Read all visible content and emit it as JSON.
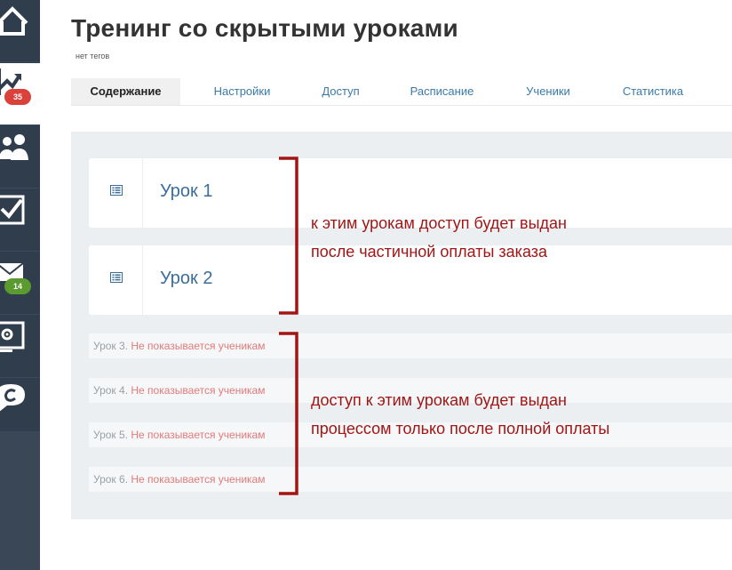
{
  "sidebar": {
    "items": [
      {
        "icon": "home-icon",
        "badge": ""
      },
      {
        "icon": "chart-line-icon",
        "badge": "35",
        "badge_color": "#d9413a"
      },
      {
        "icon": "users-icon",
        "badge": ""
      },
      {
        "icon": "checkbox-icon",
        "badge": ""
      },
      {
        "icon": "mail-icon",
        "badge": "14",
        "badge_color": "#5a9a2f"
      },
      {
        "icon": "settings-screen-icon",
        "badge": ""
      },
      {
        "icon": "chat-icon",
        "badge": ""
      }
    ]
  },
  "header": {
    "title": "Тренинг со скрытыми уроками",
    "tags": "нет тегов"
  },
  "tabs": [
    {
      "label": "Содержание",
      "active": true
    },
    {
      "label": "Настройки",
      "active": false
    },
    {
      "label": "Доступ",
      "active": false
    },
    {
      "label": "Расписание",
      "active": false
    },
    {
      "label": "Ученики",
      "active": false
    },
    {
      "label": "Статистика",
      "active": false
    }
  ],
  "lessons": [
    {
      "title": "Урок 1",
      "icon": "lesson-list-icon"
    },
    {
      "title": "Урок 2",
      "icon": "lesson-list-icon"
    }
  ],
  "hidden_lessons": [
    {
      "label": "Урок 3.",
      "note": "Не показывается ученикам"
    },
    {
      "label": "Урок 4.",
      "note": "Не показывается ученикам"
    },
    {
      "label": "Урок 5.",
      "note": "Не показывается ученикам"
    },
    {
      "label": "Урок 6.",
      "note": "Не показывается ученикам"
    }
  ],
  "annotations": {
    "partial": [
      "к этим урокам доступ будет выдан",
      "после частичной оплаты заказа"
    ],
    "full": [
      "доступ к этим урокам будет выдан",
      "процессом только после полной оплаты"
    ],
    "color": "#a31515"
  },
  "colors": {
    "sidebar_bg": "#2f3d4c",
    "link": "#3a7aa8",
    "hidden_note": "#e07b7b"
  }
}
